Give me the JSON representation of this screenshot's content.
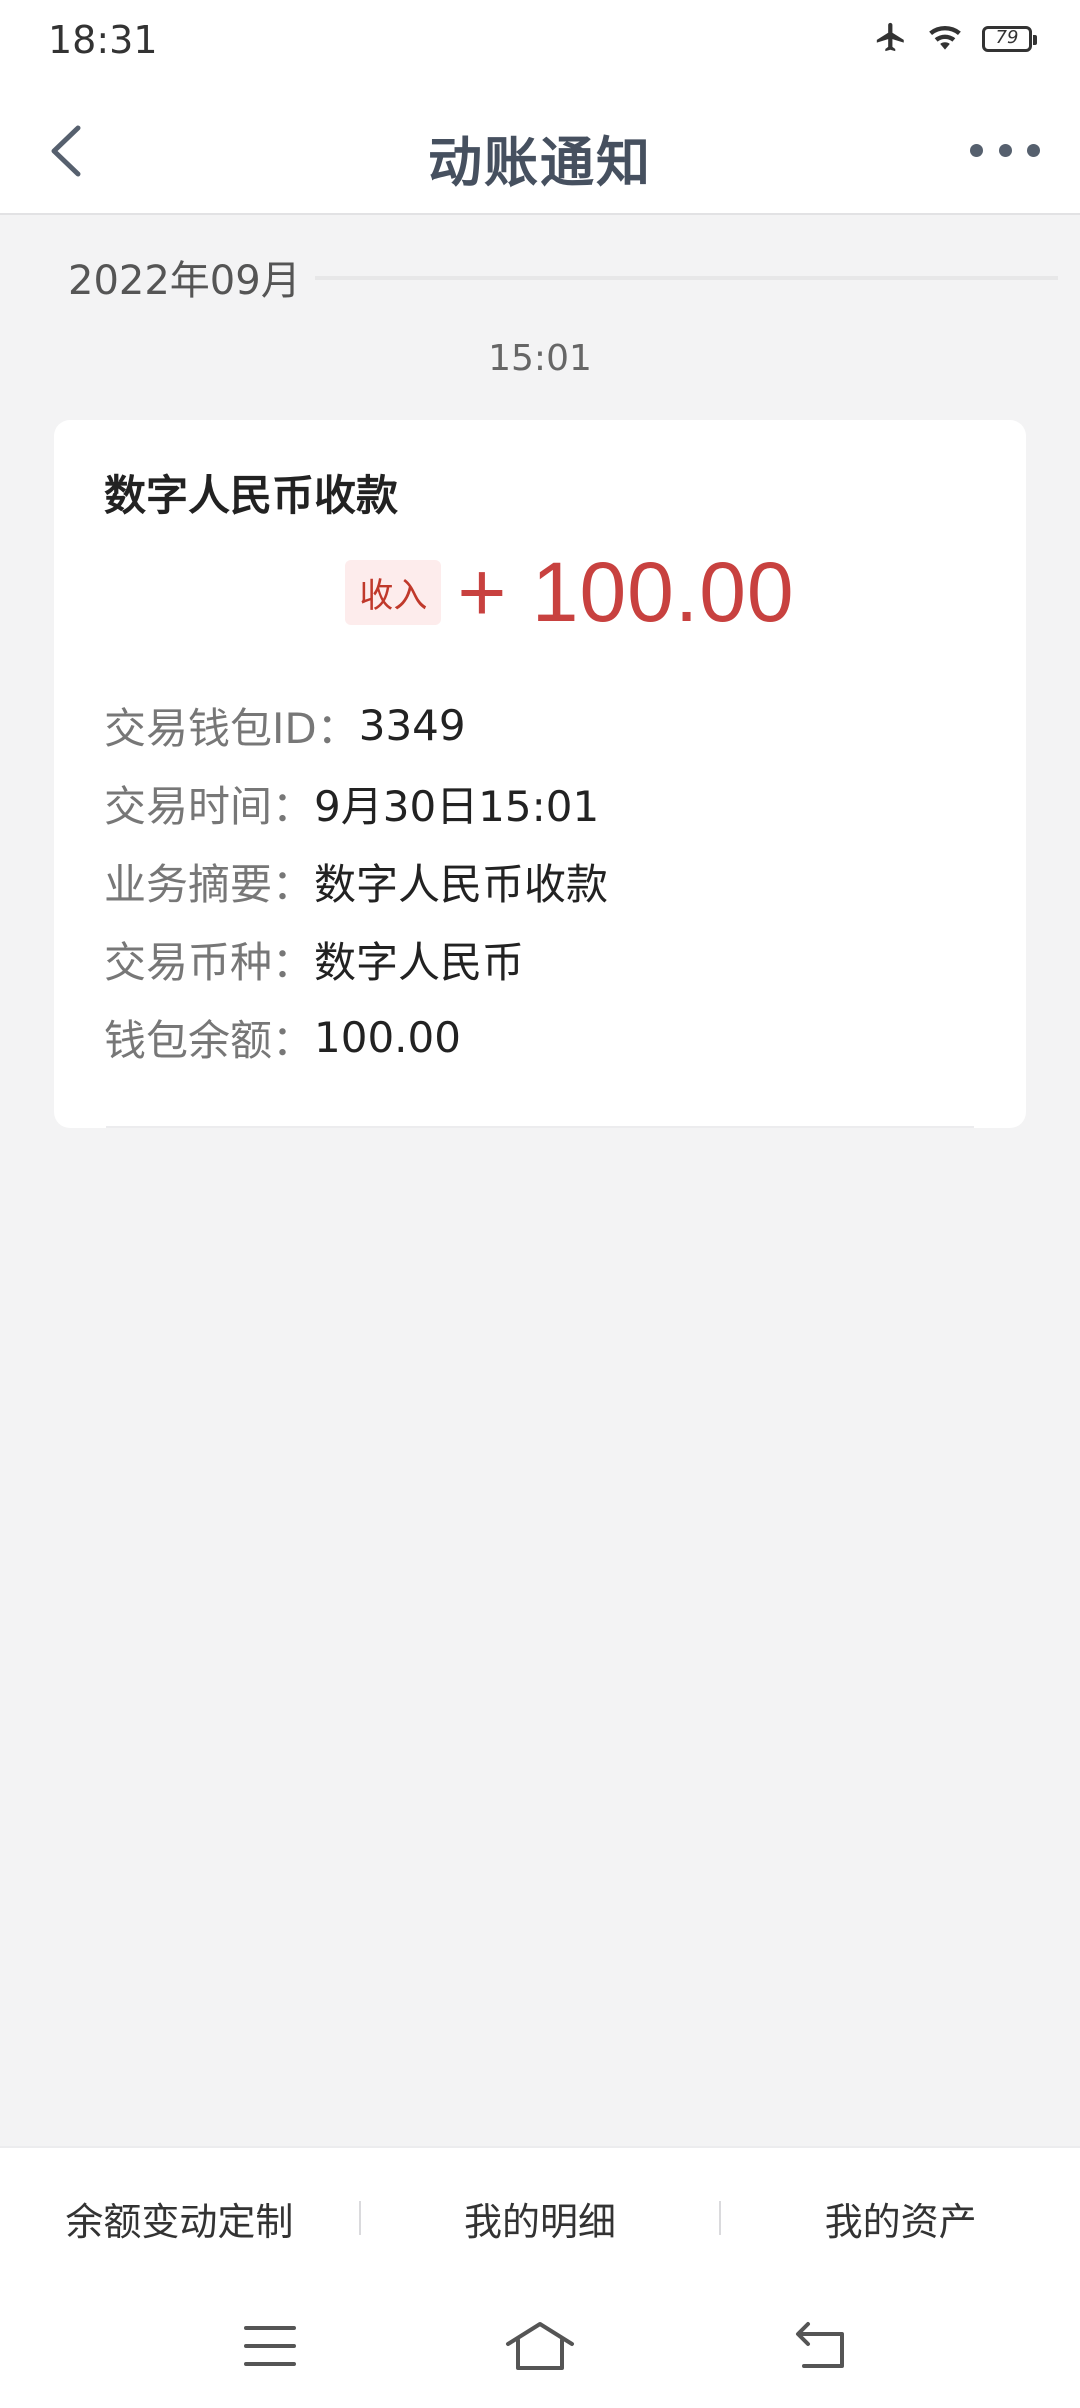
{
  "status_bar": {
    "time": "18:31",
    "battery": "79"
  },
  "header": {
    "title": "动账通知"
  },
  "feed": {
    "month": "2022年09月",
    "time": "15:01"
  },
  "card": {
    "title": "数字人民币收款",
    "badge": "收入",
    "amount": "+ 100.00",
    "details": [
      {
        "label": "交易钱包ID：",
        "value": "3349"
      },
      {
        "label": "交易时间：",
        "value": "9月30日15:01"
      },
      {
        "label": "业务摘要：",
        "value": "数字人民币收款"
      },
      {
        "label": "交易币种：",
        "value": "数字人民币"
      },
      {
        "label": "钱包余额：",
        "value": "100.00"
      }
    ]
  },
  "bottom_tabs": [
    {
      "label": "余额变动定制"
    },
    {
      "label": "我的明细"
    },
    {
      "label": "我的资产"
    }
  ],
  "colors": {
    "accent_red": "#c8413f",
    "title_slate": "#46505f",
    "background": "#f3f3f4"
  }
}
